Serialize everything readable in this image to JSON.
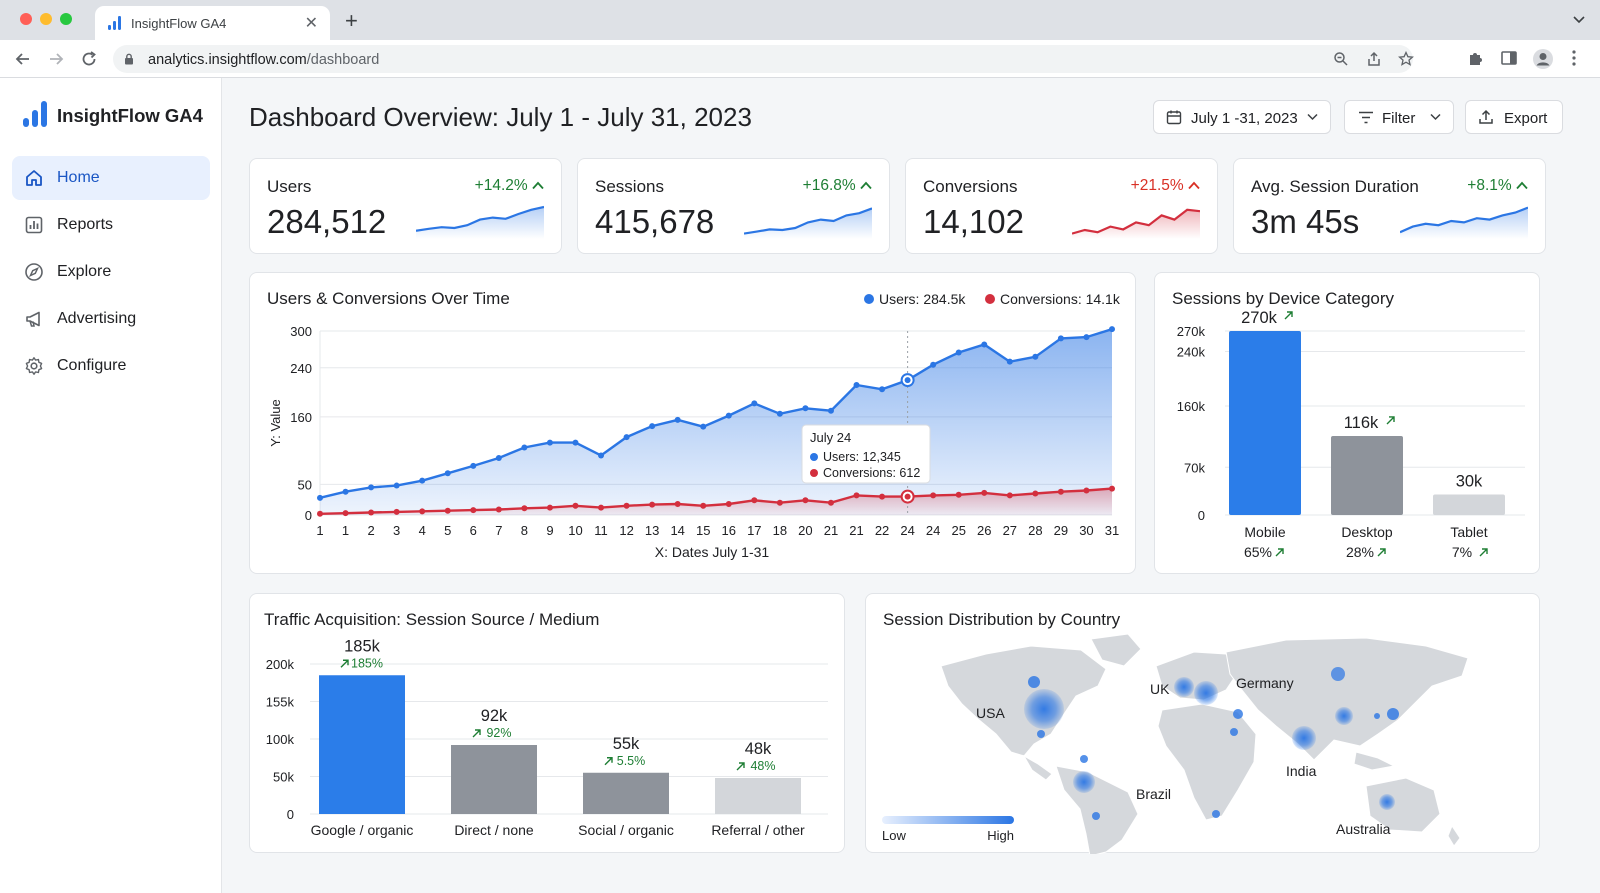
{
  "browser": {
    "tab_title": "InsightFlow GA4",
    "url_host": "analytics.insightflow.com",
    "url_path": "/dashboard"
  },
  "brand": {
    "name": "InsightFlow GA4"
  },
  "sidebar": {
    "items": [
      {
        "label": "Home",
        "icon": "home-icon",
        "active": true
      },
      {
        "label": "Reports",
        "icon": "bar-chart-icon",
        "active": false
      },
      {
        "label": "Explore",
        "icon": "compass-icon",
        "active": false
      },
      {
        "label": "Advertising",
        "icon": "megaphone-icon",
        "active": false
      },
      {
        "label": "Configure",
        "icon": "gear-icon",
        "active": false
      }
    ]
  },
  "header": {
    "title": "Dashboard Overview: July 1 - July 31, 2023",
    "date_range": "July 1 -31, 2023",
    "filter": "Filter",
    "export": "Export"
  },
  "kpis": [
    {
      "label": "Users",
      "value": "284,512",
      "delta": "+14.2%",
      "trend": [
        0.15,
        0.22,
        0.28,
        0.25,
        0.35,
        0.55,
        0.62,
        0.58,
        0.75,
        0.9,
        1.0
      ]
    },
    {
      "label": "Sessions",
      "value": "415,678",
      "delta": "+16.8%",
      "trend": [
        0.05,
        0.12,
        0.2,
        0.18,
        0.25,
        0.45,
        0.55,
        0.5,
        0.7,
        0.78,
        0.95
      ]
    },
    {
      "label": "Conversions",
      "value": "14,102",
      "delta": "+21.5%",
      "trend": [
        0.05,
        0.18,
        0.1,
        0.3,
        0.2,
        0.45,
        0.35,
        0.7,
        0.55,
        0.9,
        0.85
      ]
    },
    {
      "label": "Avg. Session Duration",
      "value": "3m 45s",
      "delta": "+8.1%",
      "trend": [
        0.1,
        0.3,
        0.4,
        0.35,
        0.5,
        0.45,
        0.6,
        0.55,
        0.7,
        0.8,
        0.98
      ]
    }
  ],
  "colors": {
    "users": "#2b76e4",
    "conversions": "#d32f3e",
    "positive": "#1e7e34",
    "negative": "#d93025",
    "bar_primary": "#2b7de9",
    "bar_gray": "#8e939b",
    "bar_light": "#d3d6da"
  },
  "chart_data": [
    {
      "type": "line",
      "title": "Users & Conversions Over Time",
      "xlabel": "X: Dates July 1-31",
      "ylabel": "Y: Value",
      "x": [
        "1",
        "1",
        "2",
        "3",
        "4",
        "5",
        "6",
        "7",
        "8",
        "9",
        "10",
        "11",
        "12",
        "13",
        "14",
        "15",
        "16",
        "17",
        "18",
        "20",
        "21",
        "21",
        "22",
        "24",
        "24",
        "25",
        "26",
        "27",
        "28",
        "29",
        "30",
        "31"
      ],
      "yticks": [
        0,
        50,
        160,
        240,
        300
      ],
      "ylim": [
        0,
        300
      ],
      "legend": [
        {
          "label": "Users: 284.5k",
          "color": "#2b76e4"
        },
        {
          "label": "Conversions: 14.1k",
          "color": "#d32f3e"
        }
      ],
      "series": [
        {
          "values": [
            28,
            38,
            45,
            48,
            56,
            68,
            80,
            93,
            110,
            118,
            118,
            97,
            127,
            145,
            155,
            144,
            162,
            182,
            165,
            174,
            170,
            212,
            205,
            220,
            245,
            265,
            278,
            250,
            258,
            288,
            290,
            303
          ]
        },
        {
          "values": [
            2,
            3,
            4,
            5,
            6,
            7,
            8,
            9,
            11,
            12,
            15,
            12,
            15,
            17,
            18,
            15,
            18,
            24,
            20,
            24,
            20,
            32,
            30,
            30,
            32,
            33,
            36,
            32,
            35,
            38,
            40,
            43
          ]
        }
      ],
      "tooltip": {
        "index": 23,
        "title": "July 24",
        "users": "Users: 12,345",
        "conversions": "Conversions: 612"
      }
    },
    {
      "type": "bar",
      "title": "Sessions by Device Category",
      "categories": [
        "Mobile",
        "Desktop",
        "Tablet"
      ],
      "values": [
        270,
        116,
        30
      ],
      "value_labels": [
        "270k",
        "116k",
        "30k"
      ],
      "pct_labels": [
        "65%",
        "28%",
        "7%"
      ],
      "yticks": [
        "0",
        "70k",
        "160k",
        "240k",
        "270k"
      ],
      "ylim": [
        0,
        270
      ]
    },
    {
      "type": "bar",
      "title": "Traffic Acquisition: Session Source / Medium",
      "categories": [
        "Google / organic",
        "Direct / none",
        "Social / organic",
        "Referral / other"
      ],
      "values": [
        185,
        92,
        55,
        48
      ],
      "value_labels": [
        "185k",
        "92k",
        "55k",
        "48k"
      ],
      "pct_labels": [
        "185%",
        "92%",
        "5.5%",
        "48%"
      ],
      "yticks": [
        "0",
        "50k",
        "100k",
        "155k",
        "200k"
      ],
      "ylim": [
        0,
        200
      ]
    }
  ],
  "map": {
    "title": "Session Distribution by Country",
    "labels": [
      "USA",
      "UK",
      "Germany",
      "Brazil",
      "India",
      "Australia"
    ],
    "legend_low": "Low",
    "legend_high": "High"
  }
}
